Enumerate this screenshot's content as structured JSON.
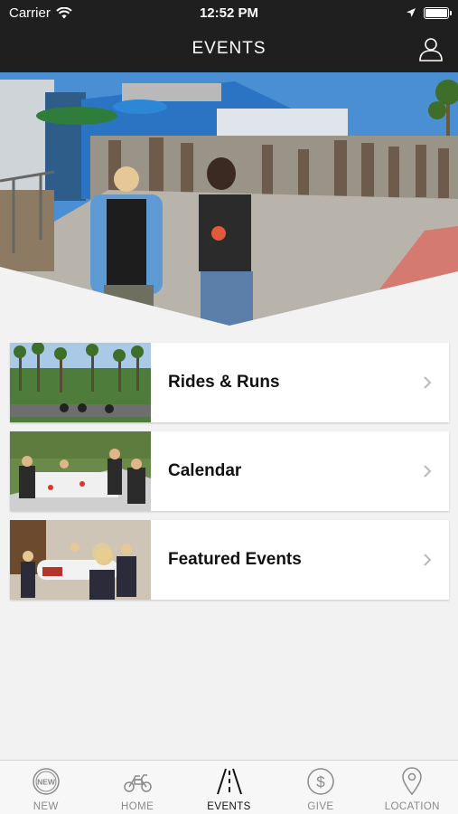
{
  "status_bar": {
    "carrier": "Carrier",
    "time": "12:52 PM"
  },
  "nav": {
    "title": "EVENTS"
  },
  "menu": {
    "items": [
      {
        "label": "Rides & Runs"
      },
      {
        "label": "Calendar"
      },
      {
        "label": "Featured Events"
      }
    ]
  },
  "tabs": [
    {
      "label": "NEW",
      "icon": "new-badge-icon"
    },
    {
      "label": "HOME",
      "icon": "motorcycle-icon"
    },
    {
      "label": "EVENTS",
      "icon": "road-icon",
      "active": true
    },
    {
      "label": "GIVE",
      "icon": "dollar-circle-icon"
    },
    {
      "label": "LOCATION",
      "icon": "map-pin-icon"
    }
  ],
  "colors": {
    "header_bg": "#1f1f1f",
    "page_bg": "#f2f2f2",
    "active_tab": "#111111",
    "inactive_tab": "#8a8a8a"
  }
}
